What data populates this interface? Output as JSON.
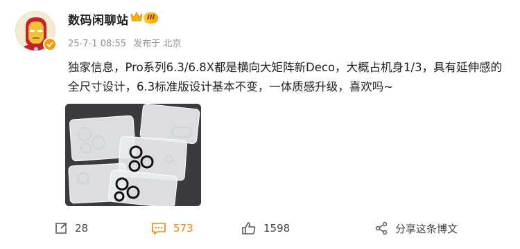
{
  "user": {
    "name": "数码闲聊站",
    "level_badge": "III"
  },
  "meta": {
    "time": "25-7-1 08:55",
    "location": "发布于 北京"
  },
  "post": {
    "text": "独家信息，Pro系列6.3/6.8X都是横向大矩阵新Deco，大概占机身1/3，具有延伸感的全尺寸设计，6.3标准版设计基本不变，一体质感升级，喜欢吗~"
  },
  "actions": {
    "repost_count": "28",
    "comment_count": "573",
    "like_count": "1598",
    "share_label": "分享这条博文"
  },
  "colors": {
    "accent": "#ff8200",
    "meta_gray": "#939393",
    "badge_gold": "#ffb300"
  },
  "icons": [
    "crown-icon",
    "verified-badge-icon",
    "repost-icon",
    "comment-icon",
    "like-icon",
    "share-icon"
  ]
}
